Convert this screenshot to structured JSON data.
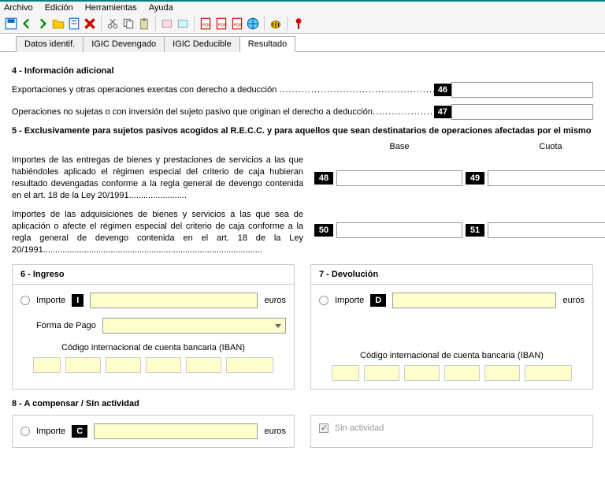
{
  "menu": {
    "archivo": "Archivo",
    "edicion": "Edición",
    "herramientas": "Herramientas",
    "ayuda": "Ayuda"
  },
  "tabs": {
    "datos": "Datos identif.",
    "devengado": "IGIC Devengado",
    "deducible": "IGIC Deducible",
    "resultado": "Resultado"
  },
  "section4": {
    "title": "4 - Información adicional",
    "row46_label": "Exportaciones y otras operaciones exentas con derecho a deducción",
    "row46_num": "46",
    "row47_label": "Operaciones no sujetas o con inversión del sujeto pasivo que originan el derecho a deducción",
    "row47_num": "47"
  },
  "section5": {
    "title": "5 - Exclusivamente para sujetos pasivos acogidos al R.E.C.C. y para aquellos que sean destinatarios de operaciones afectadas por el mismo",
    "base": "Base",
    "cuota": "Cuota",
    "block1": "Importes de las entregas de bienes y prestaciones de servicios a las que habiéndoles aplicado el  régimen especial del criterio de caja hubieran resultado devengadas conforme a la regla general de devengo contenida en el art. 18 de la Ley 20/1991........................",
    "n48": "48",
    "n49": "49",
    "block2": "Importes de las adquisiciones de bienes y servicios a las que sea de  aplicación  o afecte  el régimen especial  del criterio de  caja conforme a la regla general de devengo contenida en el  art. 18 de la Ley 20/1991...........................................................................................",
    "n50": "50",
    "n51": "51"
  },
  "section6": {
    "title": "6 - Ingreso",
    "importe": "Importe",
    "letter": "I",
    "euros": "euros",
    "forma_pago": "Forma de Pago",
    "iban_label": "Código internacional de cuenta bancaria (IBAN)"
  },
  "section7": {
    "title": "7 - Devolución",
    "importe": "Importe",
    "letter": "D",
    "euros": "euros",
    "iban_label": "Código internacional de cuenta bancaria (IBAN)"
  },
  "section8": {
    "title": "8 - A compensar / Sin actividad",
    "importe": "Importe",
    "letter": "C",
    "euros": "euros",
    "sin_actividad": "Sin actividad"
  }
}
